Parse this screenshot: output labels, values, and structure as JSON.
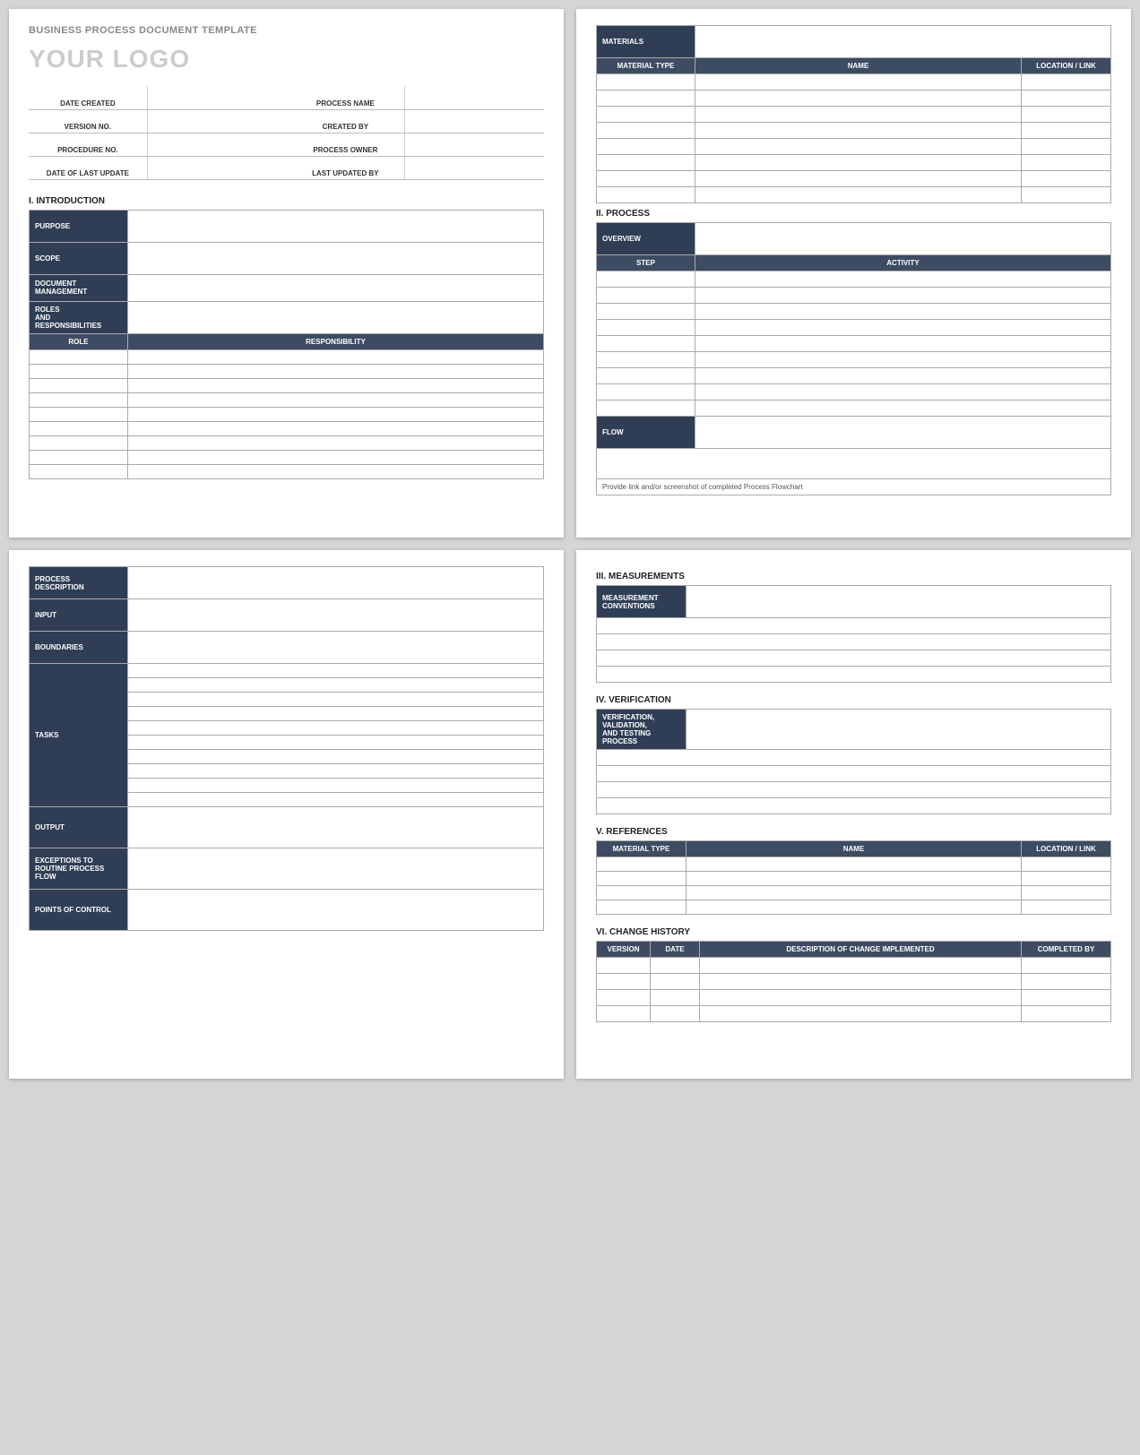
{
  "doc_title": "BUSINESS PROCESS DOCUMENT TEMPLATE",
  "logo": "YOUR LOGO",
  "meta": {
    "date_created": "DATE CREATED",
    "process_name": "PROCESS NAME",
    "version_no": "VERSION NO.",
    "created_by": "CREATED BY",
    "procedure_no": "PROCEDURE NO.",
    "process_owner": "PROCESS OWNER",
    "date_last_update": "DATE OF LAST UPDATE",
    "last_updated_by": "LAST UPDATED BY"
  },
  "sections": {
    "intro": "I.   INTRODUCTION",
    "process": "II.   PROCESS",
    "measurements": "III.  MEASUREMENTS",
    "verification": "IV.  VERIFICATION",
    "references": "V.  REFERENCES",
    "change": "VI. CHANGE HISTORY"
  },
  "labels": {
    "purpose": "PURPOSE",
    "scope": "SCOPE",
    "doc_mgmt": "DOCUMENT MANAGEMENT",
    "roles_resp": "ROLES\nAND\nRESPONSIBILITIES",
    "role": "ROLE",
    "responsibility": "RESPONSIBILITY",
    "materials": "MATERIALS",
    "material_type": "MATERIAL TYPE",
    "name": "NAME",
    "location": "LOCATION / LINK",
    "overview": "OVERVIEW",
    "step": "STEP",
    "activity": "ACTIVITY",
    "flow": "FLOW",
    "flow_note": "Provide link and/or screenshot of completed Process Flowchart",
    "process_desc": "PROCESS\nDESCRIPTION",
    "input": "INPUT",
    "boundaries": "BOUNDARIES",
    "tasks": "TASKS",
    "output": "OUTPUT",
    "exceptions": "EXCEPTIONS TO\nROUTINE PROCESS FLOW",
    "points": "POINTS OF CONTROL",
    "meas_conv": "MEASUREMENT\nCONVENTIONS",
    "verif_label": "VERIFICATION, VALIDATION,\nAND TESTING PROCESS",
    "version": "VERSION",
    "date": "DATE",
    "desc_change": "DESCRIPTION OF CHANGE IMPLEMENTED",
    "completed_by": "COMPLETED BY"
  }
}
